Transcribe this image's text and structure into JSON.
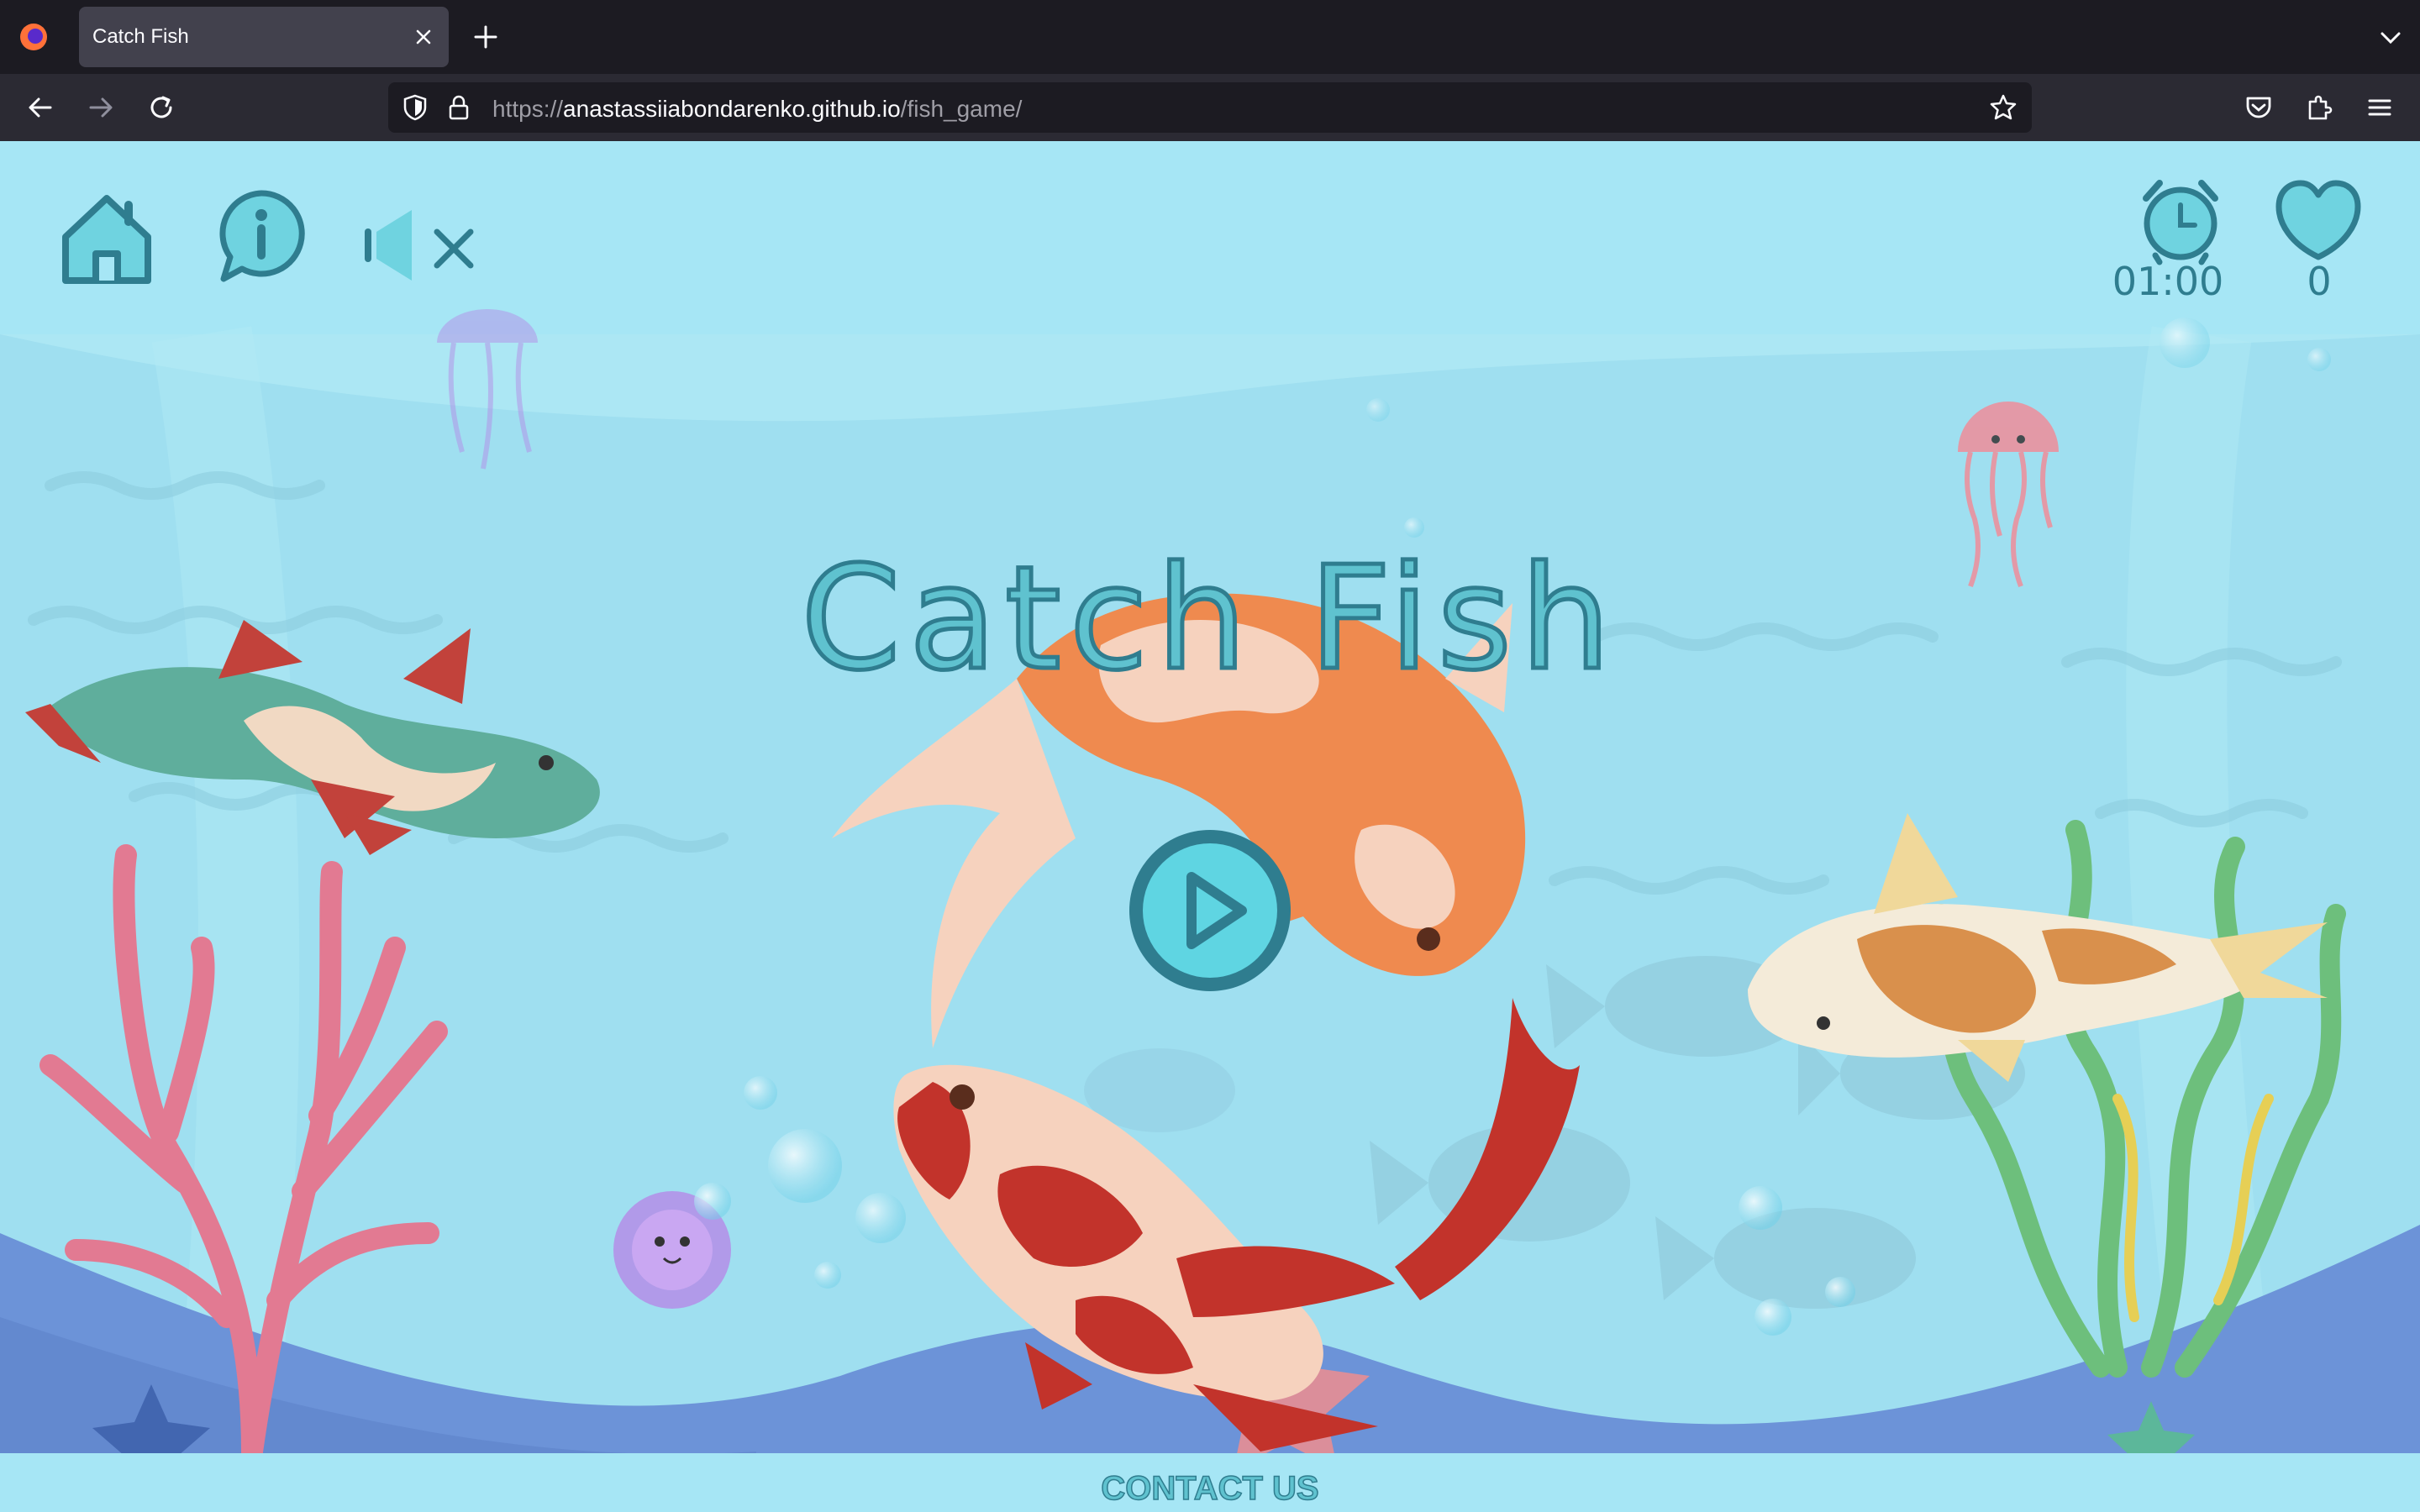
{
  "browser": {
    "tab_title": "Catch Fish",
    "url_scheme": "https://",
    "url_host": "anastassiiabondarenko.github.io",
    "url_path": "/fish_game/"
  },
  "hud": {
    "home_icon": "home-icon",
    "info_icon": "info-icon",
    "sound_icon": "sound-muted-icon",
    "timer_icon": "alarm-clock-icon",
    "timer_value": "01:00",
    "lives_icon": "heart-icon",
    "score_value": "0"
  },
  "game": {
    "title": "Catch Fish",
    "play_icon": "play-icon"
  },
  "footer": {
    "contact_label": "CONTACT US"
  },
  "colors": {
    "water": "#a6e6f5",
    "accent": "#5fc2cf",
    "outline": "#2f7d8f",
    "seabed": "#6c93d8",
    "koi_orange": "#ef8a4f",
    "koi_red": "#c2332b"
  }
}
